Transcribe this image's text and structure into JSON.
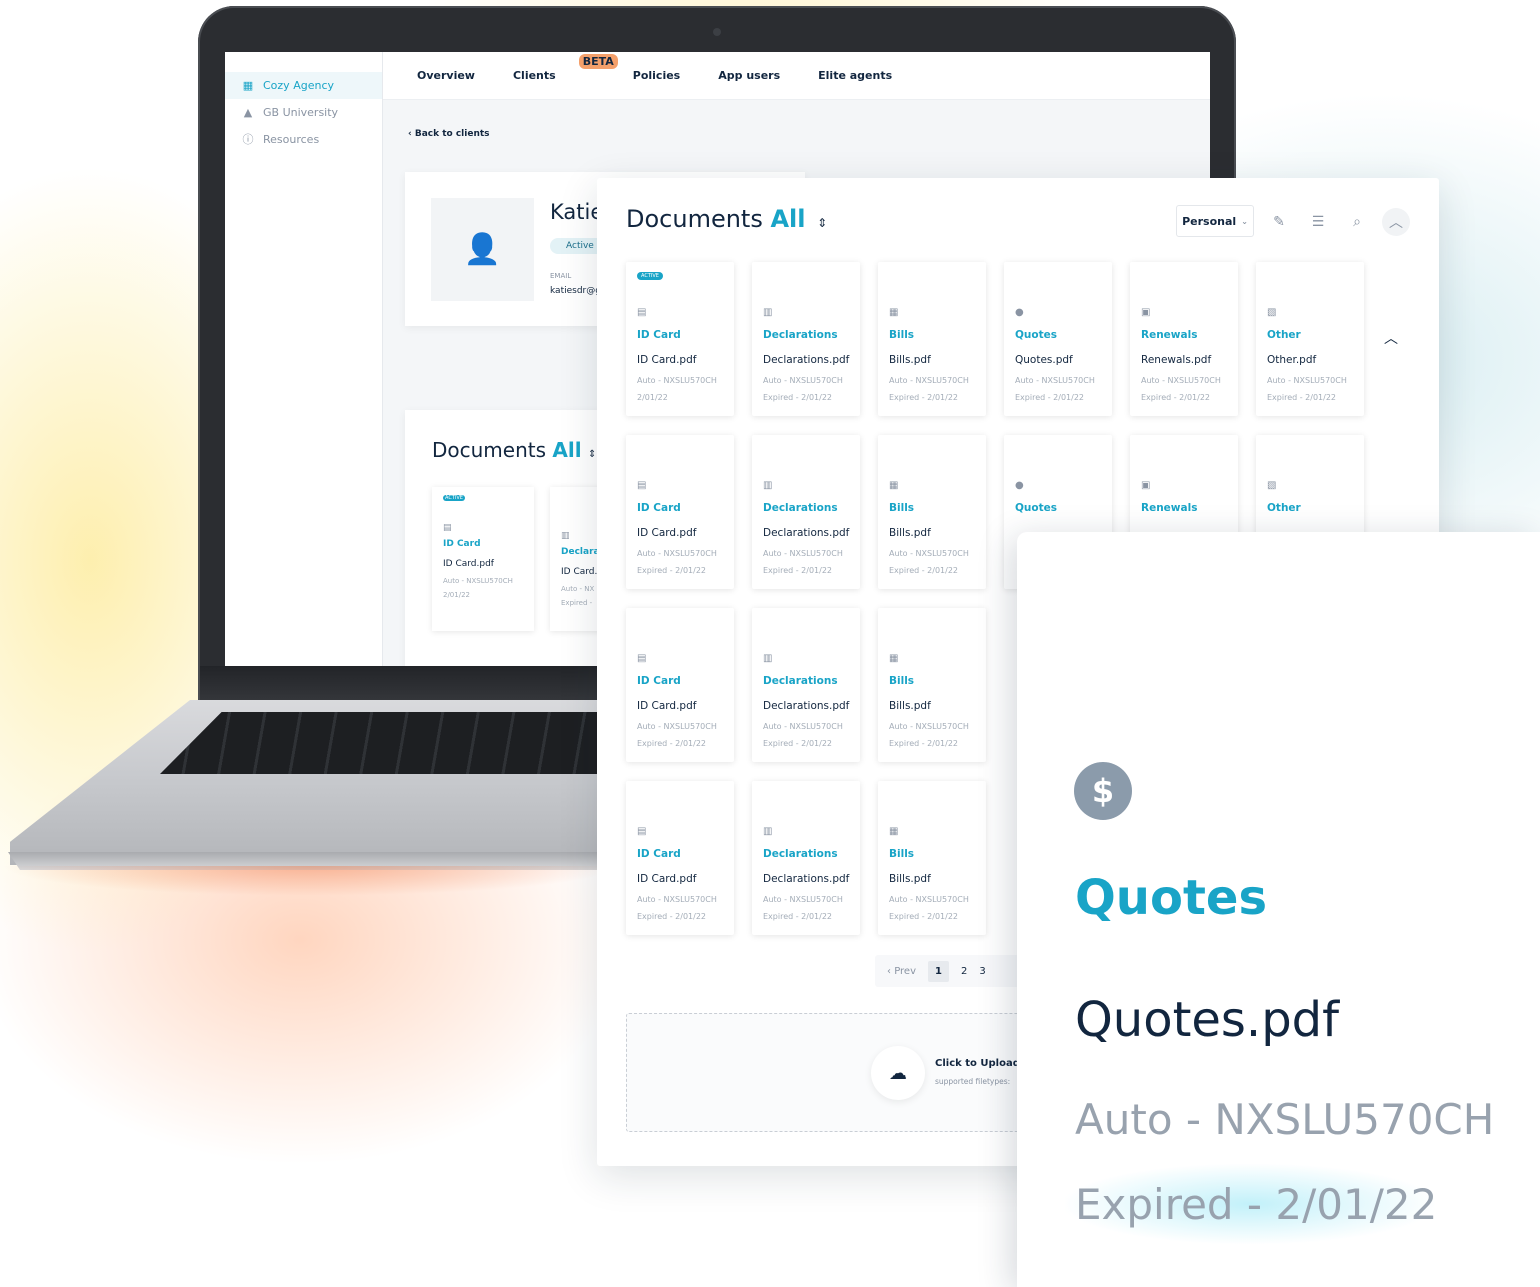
{
  "sidebar": {
    "items": [
      {
        "label": "Cozy Agency",
        "icon": "building-icon"
      },
      {
        "label": "GB University",
        "icon": "graduation-cap-icon"
      },
      {
        "label": "Resources",
        "icon": "info-icon"
      }
    ]
  },
  "topnav": {
    "items": [
      "Overview",
      "Clients",
      "Policies",
      "App users",
      "Elite agents"
    ],
    "badge": "BETA"
  },
  "back_link": "Back to clients",
  "profile": {
    "name": "Katie",
    "status": "Active",
    "email_label": "EMAIL",
    "email": "katiesdr@g"
  },
  "documents_small": {
    "title": "Documents",
    "filter": "All",
    "cards": [
      {
        "badge": "ACTIVE",
        "category": "ID Card",
        "file": "ID Card.pdf",
        "meta": "Auto - NXSLU570CH",
        "exp": "2/01/22"
      },
      {
        "category": "Declara",
        "file": "ID Card.",
        "meta": "Auto - NX",
        "exp": "Expired -"
      }
    ]
  },
  "documents": {
    "title": "Documents",
    "filter": "All",
    "sort_icon": "⇕",
    "scope_select": "Personal",
    "tools": [
      "edit-icon",
      "filter-icon",
      "search-icon",
      "collapse-icon"
    ],
    "rows": [
      [
        {
          "badge": "ACTIVE",
          "icon": "id-card-icon",
          "category": "ID Card",
          "file": "ID Card.pdf",
          "meta": "Auto - NXSLU570CH",
          "exp": "2/01/22"
        },
        {
          "icon": "declarations-icon",
          "category": "Declarations",
          "file": "Declarations.pdf",
          "meta": "Auto - NXSLU570CH",
          "exp": "Expired - 2/01/22"
        },
        {
          "icon": "bills-icon",
          "category": "Bills",
          "file": "Bills.pdf",
          "meta": "Auto - NXSLU570CH",
          "exp": "Expired - 2/01/22"
        },
        {
          "icon": "quotes-icon",
          "category": "Quotes",
          "file": "Quotes.pdf",
          "meta": "Auto - NXSLU570CH",
          "exp": "Expired - 2/01/22"
        },
        {
          "icon": "renewals-icon",
          "category": "Renewals",
          "file": "Renewals.pdf",
          "meta": "Auto - NXSLU570CH",
          "exp": "Expired - 2/01/22"
        },
        {
          "icon": "other-icon",
          "category": "Other",
          "file": "Other.pdf",
          "meta": "Auto - NXSLU570CH",
          "exp": "Expired - 2/01/22"
        }
      ],
      [
        {
          "icon": "id-card-icon",
          "category": "ID Card",
          "file": "ID Card.pdf",
          "meta": "Auto - NXSLU570CH",
          "exp": "Expired - 2/01/22"
        },
        {
          "icon": "declarations-icon",
          "category": "Declarations",
          "file": "Declarations.pdf",
          "meta": "Auto - NXSLU570CH",
          "exp": "Expired - 2/01/22"
        },
        {
          "icon": "bills-icon",
          "category": "Bills",
          "file": "Bills.pdf",
          "meta": "Auto - NXSLU570CH",
          "exp": "Expired - 2/01/22"
        },
        {
          "icon": "quotes-icon",
          "category": "Quotes",
          "file": "",
          "meta": "",
          "exp": ""
        },
        {
          "icon": "renewals-icon",
          "category": "Renewals",
          "file": "",
          "meta": "",
          "exp": ""
        },
        {
          "icon": "other-icon",
          "category": "Other",
          "file": "",
          "meta": "",
          "exp": ""
        }
      ],
      [
        {
          "icon": "id-card-icon",
          "category": "ID Card",
          "file": "ID Card.pdf",
          "meta": "Auto - NXSLU570CH",
          "exp": "Expired - 2/01/22"
        },
        {
          "icon": "declarations-icon",
          "category": "Declarations",
          "file": "Declarations.pdf",
          "meta": "Auto - NXSLU570CH",
          "exp": "Expired - 2/01/22"
        },
        {
          "icon": "bills-icon",
          "category": "Bills",
          "file": "Bills.pdf",
          "meta": "Auto - NXSLU570CH",
          "exp": "Expired - 2/01/22"
        }
      ],
      [
        {
          "icon": "id-card-icon",
          "category": "ID Card",
          "file": "ID Card.pdf",
          "meta": "Auto - NXSLU570CH",
          "exp": "Expired - 2/01/22"
        },
        {
          "icon": "declarations-icon",
          "category": "Declarations",
          "file": "Declarations.pdf",
          "meta": "Auto - NXSLU570CH",
          "exp": "Expired - 2/01/22"
        },
        {
          "icon": "bills-icon",
          "category": "Bills",
          "file": "Bills.pdf",
          "meta": "Auto - NXSLU570CH",
          "exp": "Expired - 2/01/22"
        }
      ]
    ],
    "pagination": {
      "prev": "Prev",
      "pages": [
        "1",
        "2",
        "3"
      ],
      "current": "1"
    },
    "upload": {
      "label": "Click to Upload o",
      "sub": "supported filetypes:"
    }
  },
  "zoom_card": {
    "icon": "dollar-icon",
    "category": "Quotes",
    "file": "Quotes.pdf",
    "meta": "Auto - NXSLU570CH",
    "exp": "Expired - 2/01/22"
  },
  "colors": {
    "accent": "#19a4c7",
    "text": "#12263f",
    "muted": "#a4adb8",
    "beta": "#f4a06b"
  }
}
